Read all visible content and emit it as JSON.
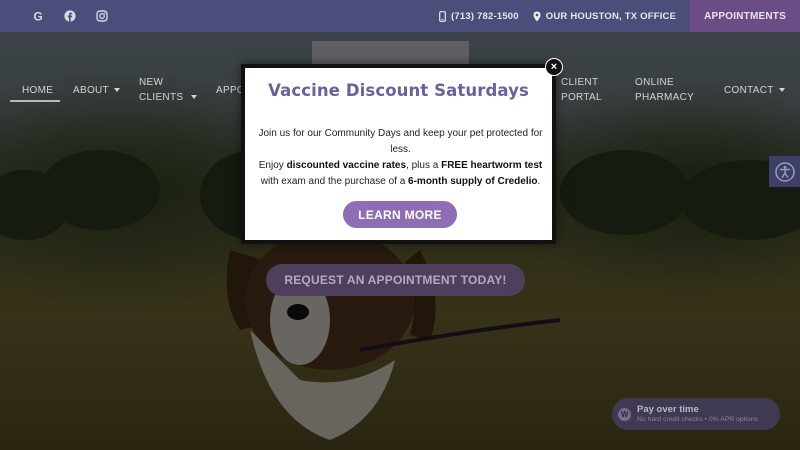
{
  "colors": {
    "topbar_bg": "#4b4d7a",
    "appointments_tab_bg": "#6b4d86",
    "modal_title": "#6b5f9d",
    "learn_more_bg": "#8d6eb5",
    "cta_bg": "#4e3f5c"
  },
  "topbar": {
    "social_icons": [
      "google-icon",
      "facebook-icon",
      "instagram-icon"
    ],
    "phone": "(713) 782-1500",
    "office": "OUR HOUSTON, TX OFFICE",
    "appointments": "APPOINTMENTS"
  },
  "nav": {
    "home": "HOME",
    "about": "ABOUT",
    "new_clients_line1": "NEW",
    "new_clients_line2": "CLIENTS",
    "appointments_partial": "APPO",
    "client_portal_line1": "CLIENT",
    "client_portal_line2": "PORTAL",
    "online_pharmacy_line1": "ONLINE",
    "online_pharmacy_line2": "PHARMACY",
    "contact": "CONTACT"
  },
  "hero": {
    "cta": "REQUEST AN APPOINTMENT TODAY!"
  },
  "modal": {
    "title": "Vaccine Discount Saturdays",
    "line1": "Join us for our Community Days and keep your pet protected for less.",
    "line2_pre": "Enjoy ",
    "line2_bold1": "discounted vaccine rates",
    "line2_mid": ", plus a ",
    "line2_bold2": "FREE heartworm test",
    "line3_pre": "with exam and the purchase of a ",
    "line3_bold": "6-month supply of Credelio",
    "line3_post": ".",
    "button": "LEARN MORE",
    "close": "×"
  },
  "pay_widget": {
    "logo": "W",
    "title": "Pay over time",
    "subtitle": "No hard credit checks • 0% APR options"
  },
  "accessibility": {
    "icon": "accessibility-icon"
  }
}
